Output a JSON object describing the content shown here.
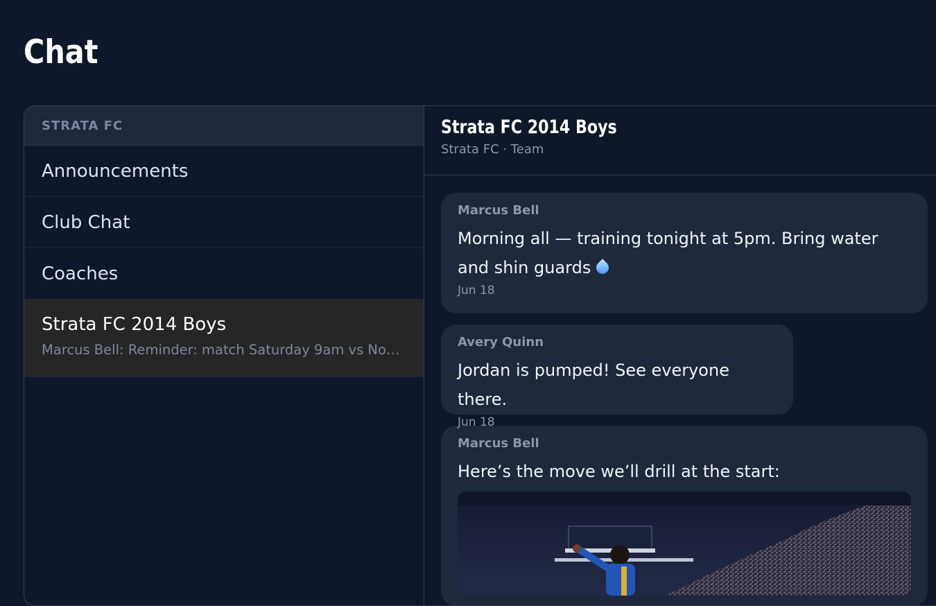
{
  "page": {
    "title": "Chat"
  },
  "sidebar": {
    "org": "STRATA FC",
    "channels": [
      {
        "name": "Announcements"
      },
      {
        "name": "Club Chat"
      },
      {
        "name": "Coaches"
      },
      {
        "name": "Strata FC 2014 Boys",
        "preview": "Marcus Bell: Reminder: match Saturday 9am vs No…",
        "active": true
      }
    ]
  },
  "conversation": {
    "title": "Strata FC 2014 Boys",
    "subtitle": "Strata FC · Team",
    "messages": [
      {
        "sender": "Marcus Bell",
        "text": "Morning all — training tonight at 5pm. Bring water and shin guards",
        "emoji": "droplet-icon",
        "time": "Jun 18"
      },
      {
        "sender": "Avery Quinn",
        "text": "Jordan is pumped! See everyone there.",
        "time": "Jun 18"
      },
      {
        "sender": "Marcus Bell",
        "text": "Here’s the move we’ll drill at the start:",
        "attachment": "soccer-player-photo"
      }
    ]
  },
  "colors": {
    "background": "#0f172a",
    "panel": "#1e293b",
    "active_channel": "#262626",
    "border": "#334155",
    "muted_text": "#8b97aa"
  }
}
